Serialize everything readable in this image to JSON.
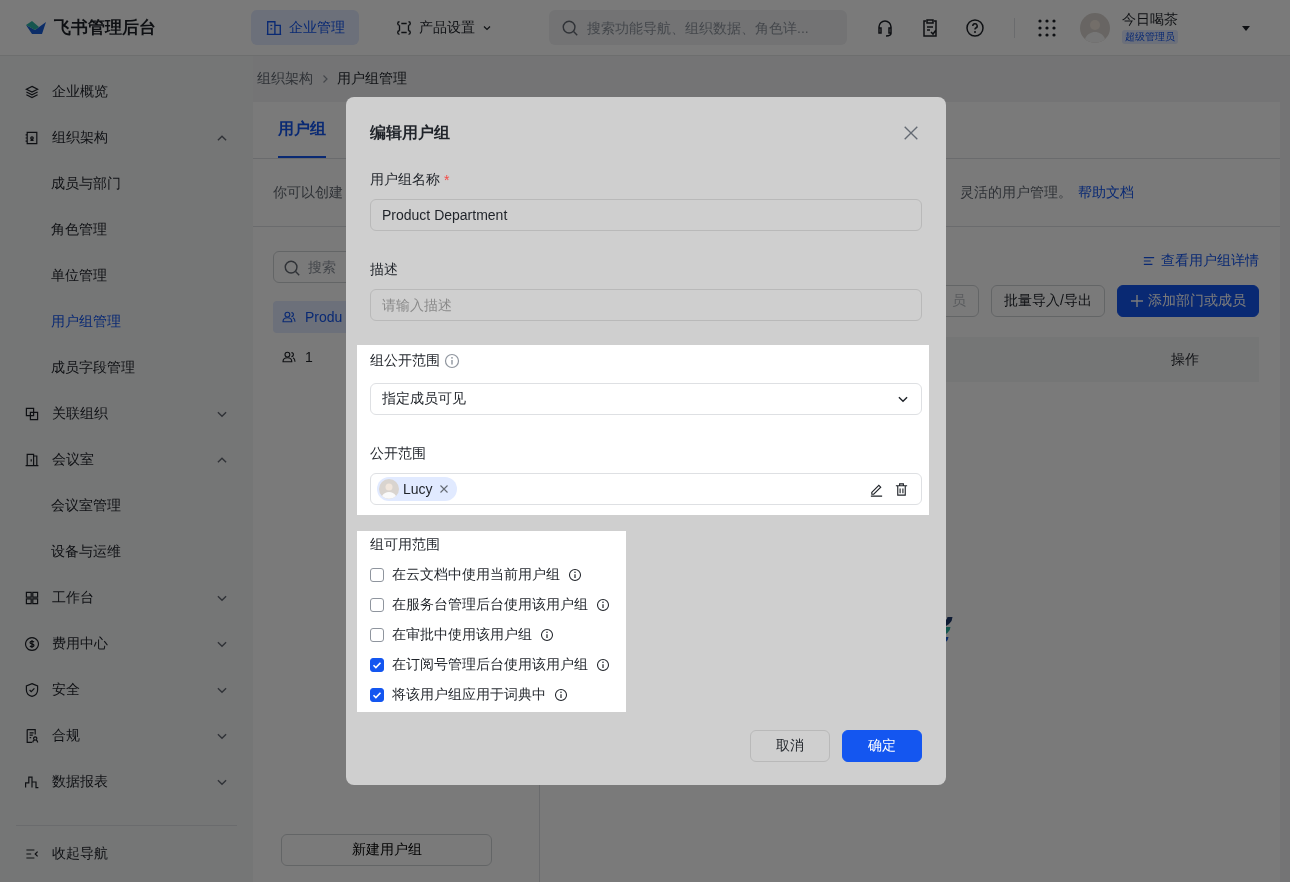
{
  "app": {
    "name": "飞书管理后台"
  },
  "topbar": {
    "nav": [
      {
        "label": "企业管理",
        "selected": true,
        "has_menu": false
      },
      {
        "label": "产品设置",
        "selected": false,
        "has_menu": true
      }
    ],
    "search": {
      "placeholder": "搜索功能导航、组织数据、角色详..."
    },
    "user": {
      "name": "今日喝茶",
      "role": "超级管理员"
    }
  },
  "sidebar": {
    "items": [
      {
        "label": "企业概览",
        "selected": false
      },
      {
        "label": "组织架构",
        "selected": false,
        "expanded": true,
        "children": [
          {
            "label": "成员与部门",
            "selected": false
          },
          {
            "label": "角色管理",
            "selected": false
          },
          {
            "label": "单位管理",
            "selected": false
          },
          {
            "label": "用户组管理",
            "selected": true
          },
          {
            "label": "成员字段管理",
            "selected": false
          }
        ]
      },
      {
        "label": "关联组织",
        "selected": false,
        "expanded": false
      },
      {
        "label": "会议室",
        "selected": false,
        "expanded": true,
        "children": [
          {
            "label": "会议室管理",
            "selected": false
          },
          {
            "label": "设备与运维",
            "selected": false
          }
        ]
      },
      {
        "label": "工作台",
        "selected": false,
        "expanded": false
      },
      {
        "label": "费用中心",
        "selected": false,
        "expanded": false
      },
      {
        "label": "安全",
        "selected": false,
        "expanded": false
      },
      {
        "label": "合规",
        "selected": false,
        "expanded": false
      },
      {
        "label": "数据报表",
        "selected": false,
        "expanded": false
      }
    ],
    "collapse": "收起导航"
  },
  "breadcrumb": [
    "组织架构",
    "用户组管理"
  ],
  "tabs": [
    {
      "label": "用户组",
      "selected": true
    }
  ],
  "intro": {
    "start": "你可以创建",
    "end": "灵活的用户管理。",
    "link": "帮助文档"
  },
  "groups": {
    "search_placeholder": "搜索",
    "items": [
      {
        "name": "Produ",
        "selected": true
      },
      {
        "name": "1",
        "selected": false
      }
    ],
    "new_button": "新建用户组"
  },
  "detail_link": "查看用户组详情",
  "actions": [
    {
      "label": "员",
      "kind": "plain",
      "disabled": true
    },
    {
      "label": "批量导入/导出",
      "kind": "plain",
      "disabled": false
    },
    {
      "label": "添加部门或成员",
      "kind": "primary",
      "disabled": false
    }
  ],
  "table": {
    "columns": [
      "操作"
    ]
  },
  "modal": {
    "title": "编辑用户组",
    "name": {
      "label": "用户组名称",
      "required_mark": "*",
      "value": "Product Department",
      "highlighted": false
    },
    "description": {
      "label": "描述",
      "placeholder": "请输入描述",
      "highlighted": false
    },
    "visibility": {
      "label": "组公开范围",
      "info": true,
      "value": "指定成员可见",
      "scope_label": "公开范围",
      "members": [
        {
          "name": "Lucy"
        }
      ],
      "highlighted": true
    },
    "usage": {
      "label": "组可用范围",
      "highlighted": true,
      "options": [
        {
          "label": "在云文档中使用当前用户组",
          "checked": false,
          "info": true
        },
        {
          "label": "在服务台管理后台使用该用户组",
          "checked": false,
          "info": true
        },
        {
          "label": "在审批中使用该用户组",
          "checked": false,
          "info": true
        },
        {
          "label": "在订阅号管理后台使用该用户组",
          "checked": true,
          "info": true
        },
        {
          "label": "将该用户组应用于词典中",
          "checked": true,
          "info": true
        }
      ]
    },
    "cancel": "取消",
    "confirm": "确定"
  }
}
